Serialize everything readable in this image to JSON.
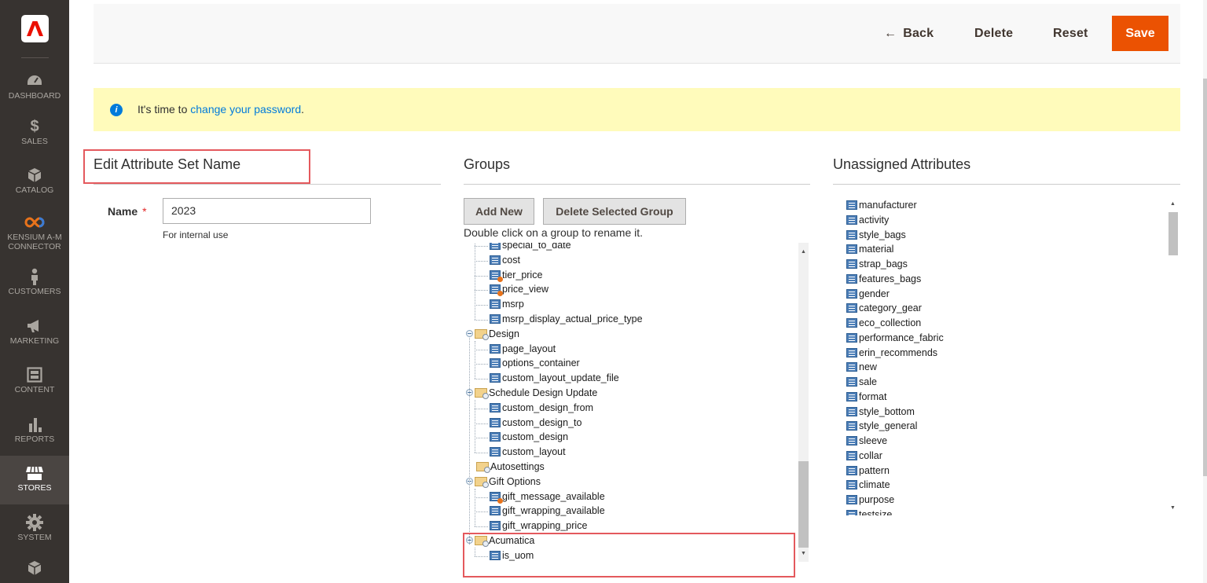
{
  "sidebar": {
    "items": [
      {
        "label": "DASHBOARD",
        "icon": "dashboard-icon"
      },
      {
        "label": "SALES",
        "icon": "dollar-icon"
      },
      {
        "label": "CATALOG",
        "icon": "cube-icon"
      },
      {
        "label": "KENSIUM A-M CONNECTOR",
        "icon": "infinity-icon"
      },
      {
        "label": "CUSTOMERS",
        "icon": "person-icon"
      },
      {
        "label": "MARKETING",
        "icon": "megaphone-icon"
      },
      {
        "label": "CONTENT",
        "icon": "layout-icon"
      },
      {
        "label": "REPORTS",
        "icon": "bar-chart-icon"
      },
      {
        "label": "STORES",
        "icon": "storefront-icon"
      },
      {
        "label": "SYSTEM",
        "icon": "gear-icon"
      },
      {
        "label": "",
        "icon": "box-icon"
      }
    ],
    "active": "STORES"
  },
  "actions": {
    "back": "Back",
    "delete": "Delete",
    "reset": "Reset",
    "save": "Save",
    "save_color": "#eb5202"
  },
  "notice": {
    "prefix": "It's time to ",
    "link": "change your password",
    "suffix": "."
  },
  "edit_section": {
    "title": "Edit Attribute Set Name",
    "name_label": "Name",
    "required_mark": "*",
    "name_value": "2023",
    "hint": "For internal use"
  },
  "groups_section": {
    "title": "Groups",
    "add_new": "Add New",
    "delete_group": "Delete Selected Group",
    "instruction": "Double click on a group to rename it.",
    "tree": [
      {
        "type": "attr",
        "label": "special_to_date"
      },
      {
        "type": "attr",
        "label": "cost"
      },
      {
        "type": "attr-user",
        "label": "tier_price"
      },
      {
        "type": "attr-user",
        "label": "price_view"
      },
      {
        "type": "attr",
        "label": "msrp"
      },
      {
        "type": "attr",
        "label": "msrp_display_actual_price_type"
      },
      {
        "type": "group",
        "label": "Design"
      },
      {
        "type": "attr",
        "label": "page_layout"
      },
      {
        "type": "attr",
        "label": "options_container"
      },
      {
        "type": "attr",
        "label": "custom_layout_update_file"
      },
      {
        "type": "group",
        "label": "Schedule Design Update"
      },
      {
        "type": "attr",
        "label": "custom_design_from"
      },
      {
        "type": "attr",
        "label": "custom_design_to"
      },
      {
        "type": "attr",
        "label": "custom_design"
      },
      {
        "type": "attr",
        "label": "custom_layout"
      },
      {
        "type": "group-empty",
        "label": "Autosettings"
      },
      {
        "type": "group",
        "label": "Gift Options"
      },
      {
        "type": "attr-user",
        "label": "gift_message_available"
      },
      {
        "type": "attr",
        "label": "gift_wrapping_available"
      },
      {
        "type": "attr",
        "label": "gift_wrapping_price"
      },
      {
        "type": "group",
        "label": "Acumatica"
      },
      {
        "type": "attr",
        "label": "is_uom"
      }
    ]
  },
  "unassigned_section": {
    "title": "Unassigned Attributes",
    "items": [
      "manufacturer",
      "activity",
      "style_bags",
      "material",
      "strap_bags",
      "features_bags",
      "gender",
      "category_gear",
      "eco_collection",
      "performance_fabric",
      "erin_recommends",
      "new",
      "sale",
      "format",
      "style_bottom",
      "style_general",
      "sleeve",
      "collar",
      "pattern",
      "climate",
      "purpose",
      "testsize"
    ]
  }
}
